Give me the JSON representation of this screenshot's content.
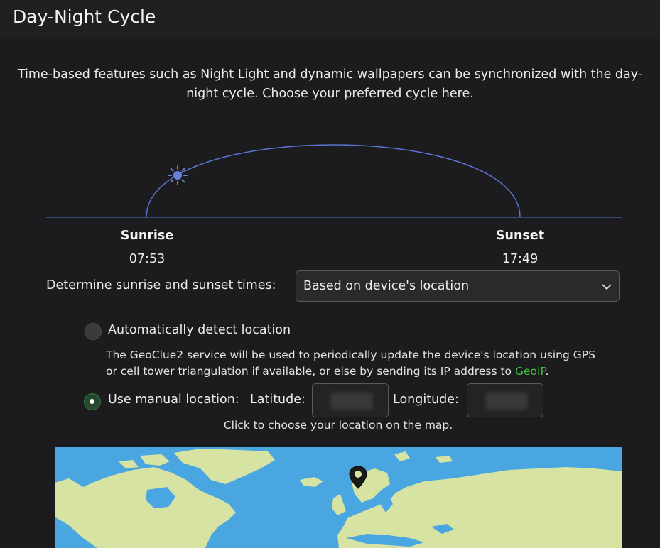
{
  "header": {
    "title": "Day-Night Cycle"
  },
  "intro": {
    "text": "Time-based features such as Night Light and dynamic wallpapers can be synchronized with the day-night cycle. Choose your preferred cycle here."
  },
  "cycle": {
    "sunrise_label": "Sunrise",
    "sunrise_time": "07:53",
    "sunset_label": "Sunset",
    "sunset_time": "17:49",
    "accent_color": "#5b74d1",
    "icon": "sun-icon"
  },
  "determine": {
    "label": "Determine sunrise and sunset times:",
    "selected": "Based on device's location",
    "icon": "chevron-down-icon"
  },
  "auto_location": {
    "label": "Automatically detect location",
    "checked": false,
    "description_prefix": "The GeoClue2 service will be used to periodically update the device's location using GPS or cell tower triangulation if available, or else by sending its IP address to ",
    "link_text": "GeoIP",
    "description_suffix": "."
  },
  "manual_location": {
    "label": "Use manual location:",
    "checked": true,
    "latitude_label": "Latitude:",
    "longitude_label": "Longitude:"
  },
  "map": {
    "hint": "Click to choose your location on the map.",
    "ocean_color": "#4aa6e0",
    "land_color": "#d7e3a2",
    "marker_icon": "map-pin-icon"
  }
}
